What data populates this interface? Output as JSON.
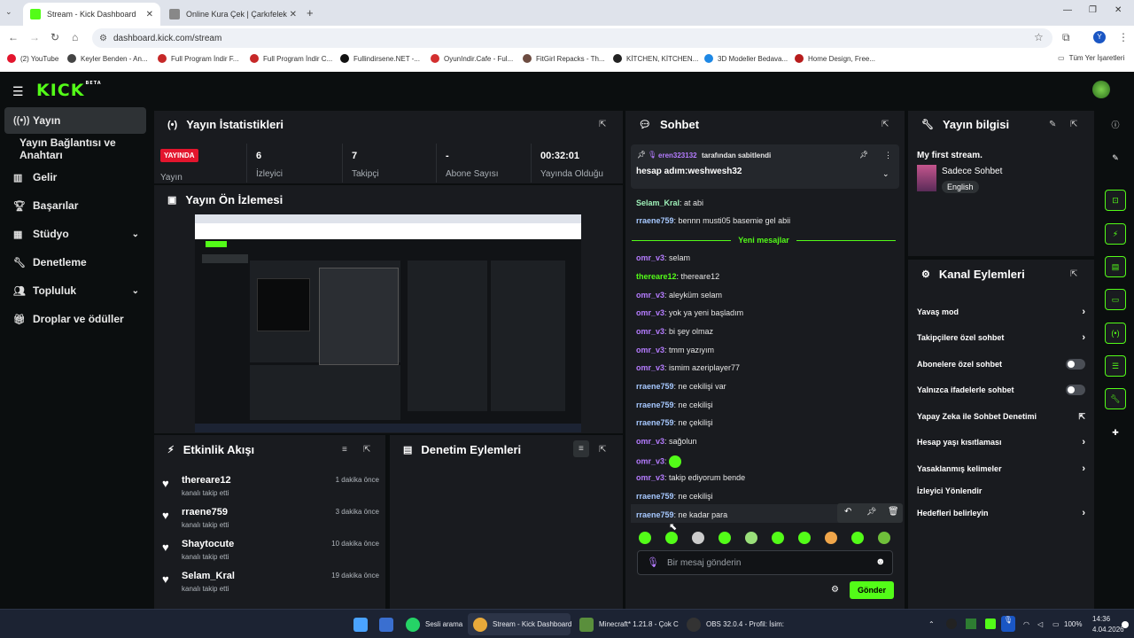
{
  "browser": {
    "tabs": [
      {
        "label": "Stream - Kick Dashboard"
      },
      {
        "label": "Online Kura Çek | Çarkıfelek"
      }
    ],
    "url": "dashboard.kick.com/stream",
    "profile": "Y",
    "bookmarks": [
      "(2) YouTube",
      "Keyler Benden - An...",
      "Full Program İndir F...",
      "Full Program İndir C...",
      "Fullindirsene.NET -...",
      "OyunIndir.Cafe - Ful...",
      "FitGirl Repacks - Th...",
      "KİTCHEN, KİTCHEN...",
      "3D Modeller Bedava...",
      "Home Design, Free..."
    ],
    "all_bookmarks": "Tüm Yer İşaretleri"
  },
  "header": {
    "logo": "KICK",
    "logo_tag": "BETA"
  },
  "sidebar": {
    "items": [
      {
        "label": "Yayın"
      },
      {
        "label": "Yayın Bağlantısı ve Anahtarı"
      },
      {
        "label": "Gelir"
      },
      {
        "label": "Başarılar"
      },
      {
        "label": "Stüdyo"
      },
      {
        "label": "Denetleme"
      },
      {
        "label": "Topluluk"
      },
      {
        "label": "Droplar ve ödüller"
      }
    ]
  },
  "stats": {
    "title": "Yayın İstatistikleri",
    "live_badge": "YAYINDA",
    "live_label": "Yayın",
    "items": [
      {
        "value": "6",
        "label": "İzleyici"
      },
      {
        "value": "7",
        "label": "Takipçi"
      },
      {
        "value": "-",
        "label": "Abone Sayısı"
      },
      {
        "value": "00:32:01",
        "label": "Yayında Olduğu"
      }
    ]
  },
  "preview": {
    "title": "Yayın Ön İzlemesi"
  },
  "activity": {
    "title": "Etkinlik Akışı",
    "items": [
      {
        "name": "thereare12",
        "sub": "kanalı takip etti",
        "time": "1 dakika önce"
      },
      {
        "name": "rraene759",
        "sub": "kanalı takip etti",
        "time": "3 dakika önce"
      },
      {
        "name": "Shaytocute",
        "sub": "kanalı takip etti",
        "time": "10 dakika önce"
      },
      {
        "name": "Selam_Kral",
        "sub": "kanalı takip etti",
        "time": "19 dakika önce"
      }
    ]
  },
  "moderation": {
    "title": "Denetim Eylemleri"
  },
  "chat": {
    "title": "Sohbet",
    "pinned": {
      "by_user": "eren323132",
      "by_text": "tarafından sabitlendi",
      "text": "hesap adım:weshwesh32"
    },
    "new_messages": "Yeni mesajlar",
    "messages": [
      {
        "user": "Selam_Kral",
        "text": ": at abi",
        "color": "#9ef0b8"
      },
      {
        "user": "rraene759",
        "text": ": bennn musti05 basemie gel abii",
        "color": "#a6c8ff"
      },
      {
        "user": "omr_v3",
        "text": ": selam",
        "color": "#b57cff"
      },
      {
        "user": "thereare12",
        "text": ": thereare12",
        "color": "#53fc18"
      },
      {
        "user": "omr_v3",
        "text": ": aleyküm selam",
        "color": "#b57cff"
      },
      {
        "user": "omr_v3",
        "text": ": yok ya yeni başladım",
        "color": "#b57cff"
      },
      {
        "user": "omr_v3",
        "text": ": bi şey olmaz",
        "color": "#b57cff"
      },
      {
        "user": "omr_v3",
        "text": ": tmm yazıyım",
        "color": "#b57cff"
      },
      {
        "user": "omr_v3",
        "text": ": ismim azeriplayer77",
        "color": "#b57cff"
      },
      {
        "user": "rraene759",
        "text": ": ne cekilişi var",
        "color": "#a6c8ff"
      },
      {
        "user": "rraene759",
        "text": ": ne cekilişi",
        "color": "#a6c8ff"
      },
      {
        "user": "rraene759",
        "text": ": ne çekilişi",
        "color": "#a6c8ff"
      },
      {
        "user": "omr_v3",
        "text": ": sağolun",
        "color": "#b57cff"
      },
      {
        "user": "omr_v3",
        "text": ": ",
        "color": "#b57cff"
      },
      {
        "user": "omr_v3",
        "text": ": takip ediyorum bende",
        "color": "#b57cff"
      },
      {
        "user": "rraene759",
        "text": ": ne cekilişi",
        "color": "#a6c8ff"
      },
      {
        "user": "rraene759",
        "text": ": ne kadar para",
        "color": "#a6c8ff"
      }
    ],
    "input_placeholder": "Bir mesaj gönderin",
    "send": "Gönder"
  },
  "info": {
    "title": "Yayın bilgisi",
    "stream_title": "My first stream.",
    "category": "Sadece Sohbet",
    "language": "English"
  },
  "channel_actions": {
    "title": "Kanal Eylemleri",
    "items": [
      {
        "label": "Yavaş mod",
        "control": "chevron"
      },
      {
        "label": "Takipçilere özel sohbet",
        "control": "chevron"
      },
      {
        "label": "Abonelere özel sohbet",
        "control": "toggle",
        "on": false
      },
      {
        "label": "Yalnızca ifadelerle sohbet",
        "control": "toggle",
        "on": false
      },
      {
        "label": "Yapay Zeka ile Sohbet Denetimi",
        "control": "external"
      },
      {
        "label": "Hesap yaşı kısıtlaması",
        "control": "chevron"
      },
      {
        "label": "Yasaklanmış kelimeler",
        "control": "chevron"
      },
      {
        "label": "İzleyici Yönlendir",
        "control": "none"
      },
      {
        "label": "Hedefleri belirleyin",
        "control": "chevron"
      }
    ]
  },
  "taskbar": {
    "items": [
      "Sesli arama",
      "Stream - Kick Dashboard",
      "Minecraft* 1.21.8 - Çok C",
      "OBS 32.0.4 - Profil: İsim:"
    ],
    "battery": "100%",
    "time": "14:36",
    "date": "4.04.2026"
  },
  "colors": {
    "accent": "#53fc18",
    "live": "#e3152d",
    "bg": "#0b0e0f",
    "panel": "#191b1f"
  }
}
